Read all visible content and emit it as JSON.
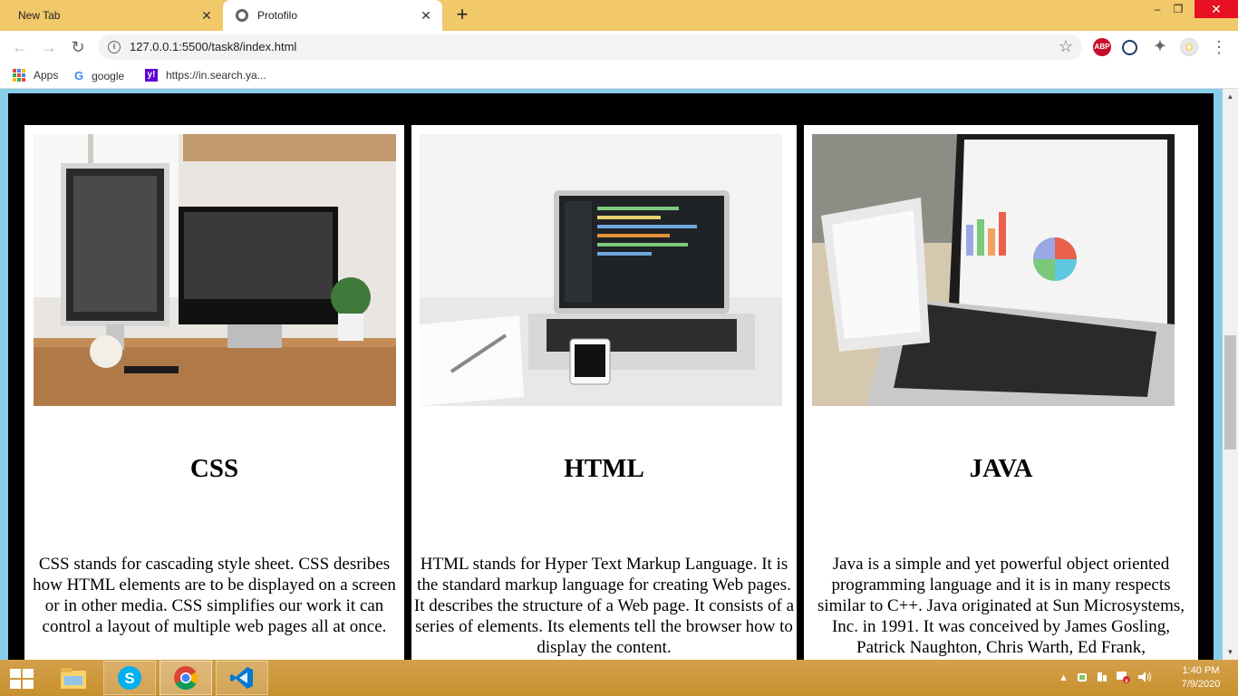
{
  "browser": {
    "tabs": [
      {
        "title": "New Tab",
        "active": false
      },
      {
        "title": "Protofilo",
        "active": true
      }
    ],
    "url": "127.0.0.1:5500/task8/index.html",
    "bookmarks": [
      {
        "label": "Apps",
        "icon": "apps-grid-icon"
      },
      {
        "label": "google",
        "icon": "google-icon"
      },
      {
        "label": "https://in.search.ya...",
        "icon": "yahoo-icon"
      }
    ],
    "extensions": {
      "abp_label": "ABP"
    },
    "window_controls": {
      "minimize": "–",
      "maximize": "❐",
      "close": "✕"
    }
  },
  "page": {
    "background_color": "#000000",
    "page_edge_color": "#87ceeb",
    "cards": [
      {
        "title": "CSS",
        "text": "CSS stands for cascading style sheet. CSS desribes how HTML elements are to be displayed on a screen or in other media. CSS simplifies our work it can control a layout of multiple web pages all at once."
      },
      {
        "title": "HTML",
        "text": "HTML stands for Hyper Text Markup Language. It is the standard markup language for creating Web pages. It describes the structure of a Web page. It consists of a series of elements. Its elements tell the browser how to display the content."
      },
      {
        "title": "JAVA",
        "text": "Java is a simple and yet powerful object oriented programming language and it is in many respects similar to C++. Java originated at Sun Microsystems, Inc. in 1991. It was conceived by James Gosling, Patrick Naughton, Chris Warth, Ed Frank,"
      }
    ]
  },
  "taskbar": {
    "apps": [
      {
        "name": "file-explorer-icon"
      },
      {
        "name": "skype-icon"
      },
      {
        "name": "chrome-icon"
      },
      {
        "name": "vscode-icon"
      }
    ],
    "clock": {
      "time": "1:40 PM",
      "date": "7/9/2020"
    },
    "tray_icons": [
      "show-hidden-icons-icon",
      "network-status-icon",
      "power-icon",
      "flag-icon",
      "volume-icon"
    ]
  }
}
